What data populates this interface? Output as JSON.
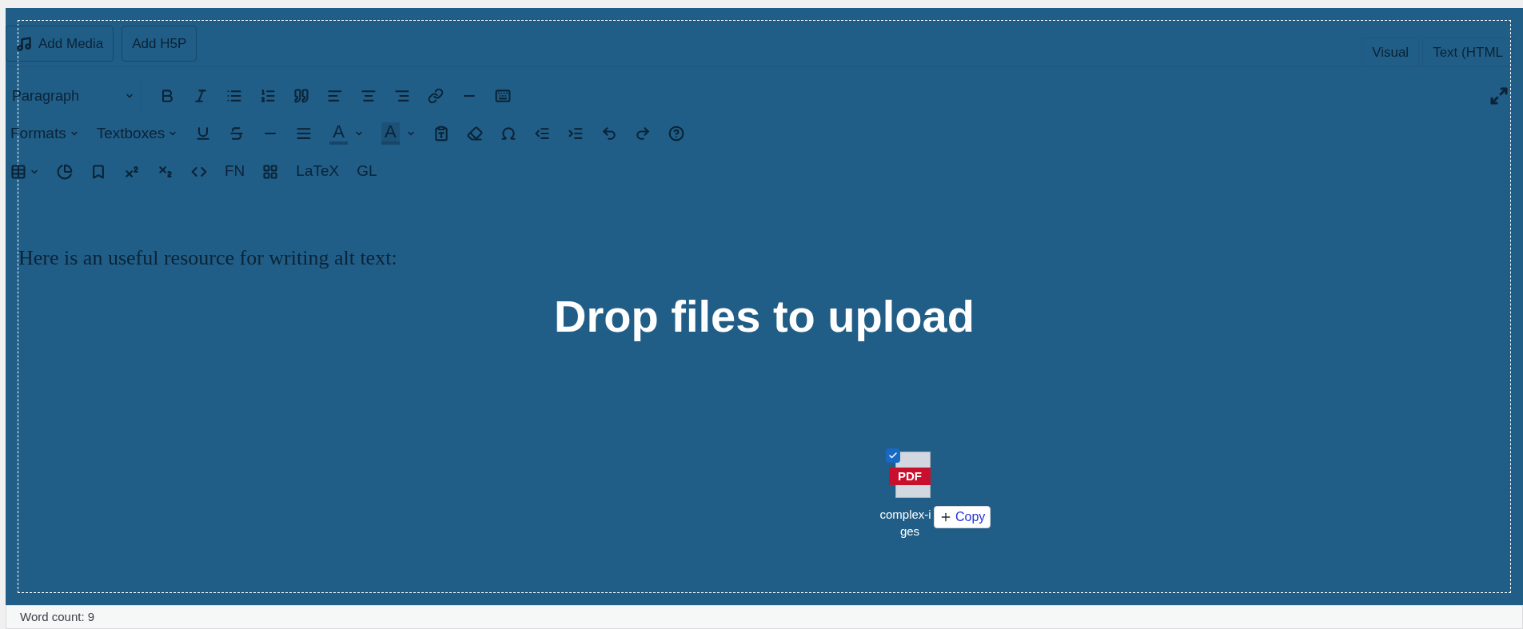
{
  "media_buttons": [
    "Add Media",
    "Add H5P"
  ],
  "editor_tabs": [
    "Visual",
    "Text (HTML"
  ],
  "toolbar": {
    "format_select": "Paragraph",
    "formats_menu": "Formats",
    "textboxes_menu": "Textboxes",
    "text_color": "A",
    "background_color": "A",
    "footnote": "FN",
    "latex": "LaTeX",
    "glossary": "GL"
  },
  "content": "Here is an useful resource for writing alt text:",
  "drop_message": "Drop files to upload",
  "dragged_file": {
    "icon_label": "PDF",
    "name_lines": [
      "complex-i",
      "ges"
    ],
    "badge": "Copy"
  },
  "status_bar": {
    "word_count": "Word count: 9"
  }
}
